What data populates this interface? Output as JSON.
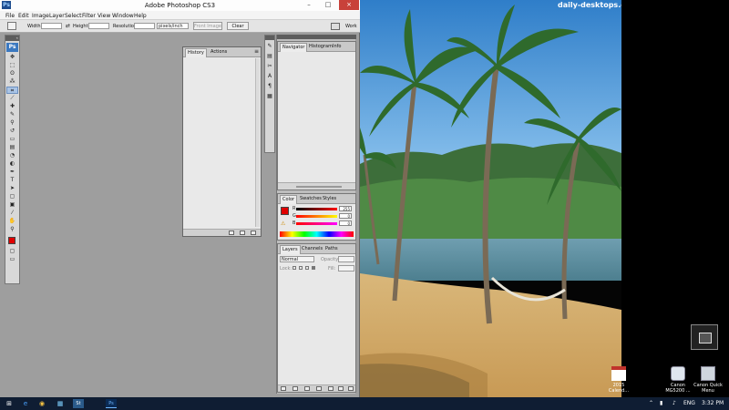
{
  "app": {
    "title": "Adobe Photoshop CS3",
    "logo": "Ps"
  },
  "window_buttons": {
    "minimize": "–",
    "maximize": "□",
    "close": "×"
  },
  "menu": [
    "File",
    "Edit",
    "Image",
    "Layer",
    "Select",
    "Filter",
    "View",
    "Window",
    "Help"
  ],
  "options_bar": {
    "width_label": "Width:",
    "height_label": "Height:",
    "resolution_label": "Resolution:",
    "units_value": "pixels/inch",
    "front_image_label": "Front Image",
    "clear_label": "Clear",
    "workspace_label": "Work"
  },
  "tools": {
    "logo": "Ps",
    "items": [
      {
        "name": "move-tool-icon",
        "glyph": "✥"
      },
      {
        "name": "marquee-tool-icon",
        "glyph": "⬚"
      },
      {
        "name": "lasso-tool-icon",
        "glyph": "ʘ"
      },
      {
        "name": "magic-wand-tool-icon",
        "glyph": "⁂"
      },
      {
        "name": "crop-tool-icon",
        "glyph": "⌗"
      },
      {
        "name": "slice-tool-icon",
        "glyph": "⟋"
      },
      {
        "name": "healing-brush-tool-icon",
        "glyph": "✚"
      },
      {
        "name": "brush-tool-icon",
        "glyph": "✎"
      },
      {
        "name": "clone-stamp-tool-icon",
        "glyph": "⚲"
      },
      {
        "name": "history-brush-tool-icon",
        "glyph": "↺"
      },
      {
        "name": "eraser-tool-icon",
        "glyph": "▭"
      },
      {
        "name": "gradient-tool-icon",
        "glyph": "▤"
      },
      {
        "name": "blur-tool-icon",
        "glyph": "◔"
      },
      {
        "name": "dodge-tool-icon",
        "glyph": "◐"
      },
      {
        "name": "pen-tool-icon",
        "glyph": "✒"
      },
      {
        "name": "type-tool-icon",
        "glyph": "T"
      },
      {
        "name": "path-selection-tool-icon",
        "glyph": "➤"
      },
      {
        "name": "shape-tool-icon",
        "glyph": "▢"
      },
      {
        "name": "notes-tool-icon",
        "glyph": "▣"
      },
      {
        "name": "eyedropper-tool-icon",
        "glyph": "⁄"
      },
      {
        "name": "hand-tool-icon",
        "glyph": "✋"
      },
      {
        "name": "zoom-tool-icon",
        "glyph": "⚲"
      }
    ]
  },
  "history_panel": {
    "tabs": [
      "History",
      "Actions"
    ]
  },
  "navigator_panel": {
    "tabs": [
      "Navigator",
      "Histogram",
      "Info"
    ]
  },
  "color_panel": {
    "tabs": [
      "Color",
      "Swatches",
      "Styles"
    ],
    "channels": [
      {
        "label": "R",
        "value": "255"
      },
      {
        "label": "G",
        "value": "0"
      },
      {
        "label": "B",
        "value": "0"
      }
    ],
    "foreground": "#e00000"
  },
  "layers_panel": {
    "tabs": [
      "Layers",
      "Channels",
      "Paths"
    ],
    "blend_mode": "Normal",
    "opacity_label": "Opacity:",
    "lock_label": "Lock:",
    "fill_label": "Fill:"
  },
  "desktop": {
    "watermark": "daily-desktops.com",
    "icons": [
      {
        "label_line1": "2015",
        "label_line2": "Calend..."
      },
      {
        "label_line1": "Canon",
        "label_line2": "MG5200 ..."
      },
      {
        "label_line1": "Canon Quick",
        "label_line2": "Menu"
      }
    ]
  },
  "taskbar": {
    "apps": [
      "⊞",
      "e",
      "◉",
      "▦",
      "St",
      "Ps"
    ],
    "language": "ENG",
    "time": "3:32 PM"
  },
  "colors": {
    "ps_blue": "#1e4d8f",
    "taskbar": "#0f1d33",
    "close_red": "#c8413a"
  }
}
